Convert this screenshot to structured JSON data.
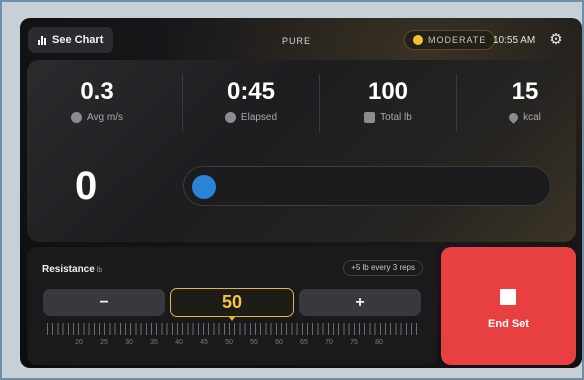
{
  "topbar": {
    "chart_button": "See Chart",
    "mode": "PURE",
    "intensity": "MODERATE",
    "time": "10:55 AM",
    "settings_icon": "gear-icon"
  },
  "stats": [
    {
      "value": "0.3",
      "label": "Avg m/s",
      "icon": "speedometer-icon"
    },
    {
      "value": "0:45",
      "label": "Elapsed",
      "icon": "clock-icon"
    },
    {
      "value": "100",
      "label": "Total lb",
      "icon": "weight-icon"
    },
    {
      "value": "15",
      "label": "kcal",
      "icon": "flame-icon"
    }
  ],
  "reps": "0",
  "progress_fraction": 0.0,
  "resistance": {
    "title": "Resistance",
    "unit": "lb",
    "hint": "+5 lb every 3 reps",
    "minus": "−",
    "plus": "+",
    "value": "50",
    "scale": [
      "20",
      "25",
      "30",
      "35",
      "40",
      "45",
      "50",
      "55",
      "60",
      "65",
      "70",
      "75",
      "80"
    ]
  },
  "end_set": {
    "label": "End Set",
    "icon": "stop-icon"
  },
  "colors": {
    "accent": "#f6c445",
    "end": "#e84040",
    "progress": "#2b83d7"
  }
}
